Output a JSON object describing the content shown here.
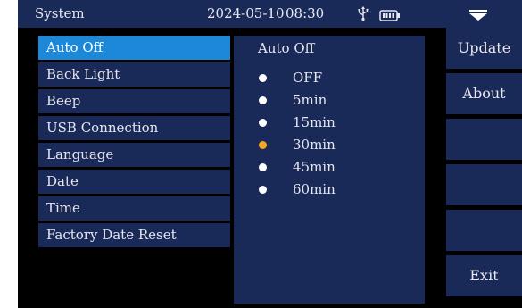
{
  "status_bar": {
    "title": "System",
    "date": "2024-05-10",
    "time": "08:30",
    "icons": [
      "usb-icon",
      "battery-icon",
      "dropdown-arrow-icon"
    ]
  },
  "menu": {
    "items": [
      {
        "label": "Auto Off",
        "active": true
      },
      {
        "label": "Back Light"
      },
      {
        "label": "Beep"
      },
      {
        "label": "USB Connection"
      },
      {
        "label": "Language"
      },
      {
        "label": "Date"
      },
      {
        "label": "Time"
      },
      {
        "label": "Factory Date Reset"
      }
    ]
  },
  "options": {
    "title": "Auto Off",
    "items": [
      {
        "label": "OFF"
      },
      {
        "label": "5min"
      },
      {
        "label": "15min"
      },
      {
        "label": "30min",
        "selected": true
      },
      {
        "label": "45min"
      },
      {
        "label": "60min"
      }
    ]
  },
  "side_buttons": [
    {
      "label": "Update"
    },
    {
      "label": "About"
    },
    {
      "label": ""
    },
    {
      "label": ""
    },
    {
      "label": ""
    },
    {
      "label": "Exit"
    }
  ],
  "colors": {
    "panel": "#1a2a58",
    "highlight": "#1e88d8",
    "selected_dot": "#f5a623",
    "background": "#000000"
  }
}
